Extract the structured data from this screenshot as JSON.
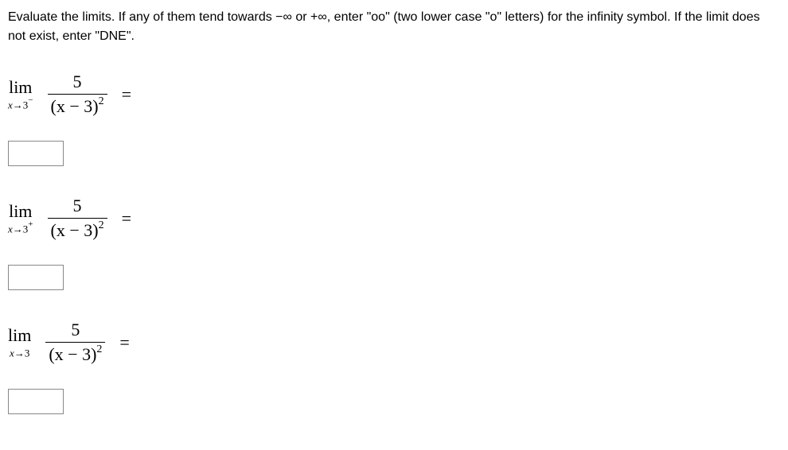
{
  "instructions": "Evaluate the limits. If any of them tend towards −∞ or +∞, enter \"oo\" (two lower case \"o\" letters) for the infinity symbol. If the limit does not exist, enter \"DNE\".",
  "problems": [
    {
      "lim": "lim",
      "sub_x": "x",
      "sub_arrow": "→",
      "sub_val": "3",
      "sub_sign": "−",
      "numerator": "5",
      "denom_left": "(x − 3)",
      "denom_exp": "2",
      "equals": "=",
      "answer": ""
    },
    {
      "lim": "lim",
      "sub_x": "x",
      "sub_arrow": "→",
      "sub_val": "3",
      "sub_sign": "+",
      "numerator": "5",
      "denom_left": "(x − 3)",
      "denom_exp": "2",
      "equals": "=",
      "answer": ""
    },
    {
      "lim": "lim",
      "sub_x": "x",
      "sub_arrow": "→",
      "sub_val": "3",
      "sub_sign": "",
      "numerator": "5",
      "denom_left": "(x − 3)",
      "denom_exp": "2",
      "equals": "=",
      "answer": ""
    }
  ]
}
